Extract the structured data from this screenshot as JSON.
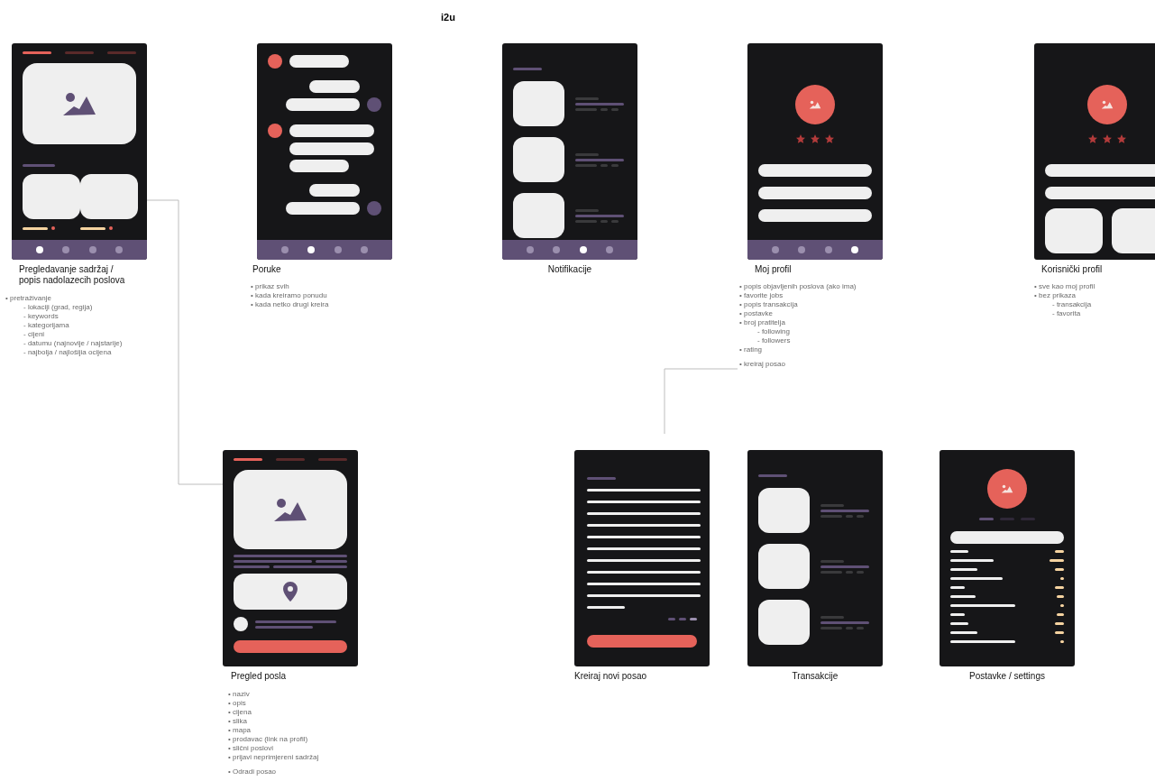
{
  "canvas_title": "i2u",
  "screens": [
    {
      "kind": "feed",
      "title": "Pregledavanje sadržaj /\npopis nadolazecih poslova",
      "tabs": [
        {
          "selected": true
        },
        {
          "selected": false
        },
        {
          "selected": false
        }
      ],
      "nav": [
        {
          "selected": true
        },
        {
          "selected": false
        },
        {
          "selected": false
        },
        {
          "selected": false
        }
      ],
      "note_groups": [
        [
          "• pretraživanje",
          "- lokaciji (grad, regija)",
          "- keywords",
          "- kategorijama",
          "- cijeni",
          "- datumu (najnovije / najstarije)",
          "- najbolja / najlošijia ocijena"
        ]
      ]
    },
    {
      "kind": "messages",
      "title": "Poruke",
      "nav": [
        {
          "selected": false
        },
        {
          "selected": true
        },
        {
          "selected": false
        },
        {
          "selected": false
        }
      ],
      "note_groups": [
        [
          "• prikaz svih",
          "• kada kreiramo ponudu",
          "• kada netko drugi kreira"
        ]
      ]
    },
    {
      "kind": "notifications",
      "title": "Notifikacije",
      "nav": [
        {
          "selected": false
        },
        {
          "selected": false
        },
        {
          "selected": true
        },
        {
          "selected": false
        }
      ]
    },
    {
      "kind": "profile",
      "title": "Moj profil",
      "stars": 3,
      "nav": [
        {
          "selected": false
        },
        {
          "selected": false
        },
        {
          "selected": false
        },
        {
          "selected": true
        }
      ],
      "note_groups": [
        [
          "• popis objavljenih poslova (ako ima)",
          "• favorite jobs",
          "• popis transakcija",
          "• postavke",
          "• broj pratitelja",
          "- following",
          "- followers",
          "• rating"
        ],
        [
          "• kreiraj posao"
        ]
      ]
    },
    {
      "kind": "user_profile",
      "title": "Korisnički profil",
      "stars": 3,
      "note_groups": [
        [
          "• sve kao moj profil",
          "• bez prikaza",
          "- transakcija",
          "- favorita"
        ]
      ]
    },
    {
      "kind": "job",
      "title": "Pregled posla",
      "tabs": [
        {
          "selected": true
        },
        {
          "selected": false
        },
        {
          "selected": false
        }
      ],
      "note_groups": [
        [
          "• naziv",
          "• opis",
          "• cijena",
          "• slika",
          "• mapa",
          "• prodavac (link na profil)",
          "• slični poslovi",
          "• prijavi neprimjereni sadržaj"
        ],
        [
          "• Odradi posao"
        ]
      ]
    },
    {
      "kind": "create",
      "title": "Kreiraj novi posao"
    },
    {
      "kind": "transactions",
      "title": "Transakcije"
    },
    {
      "kind": "settings",
      "title": "Postavke / settings",
      "tabs": [
        {
          "selected": true
        },
        {
          "selected": false
        },
        {
          "selected": false
        }
      ]
    }
  ]
}
